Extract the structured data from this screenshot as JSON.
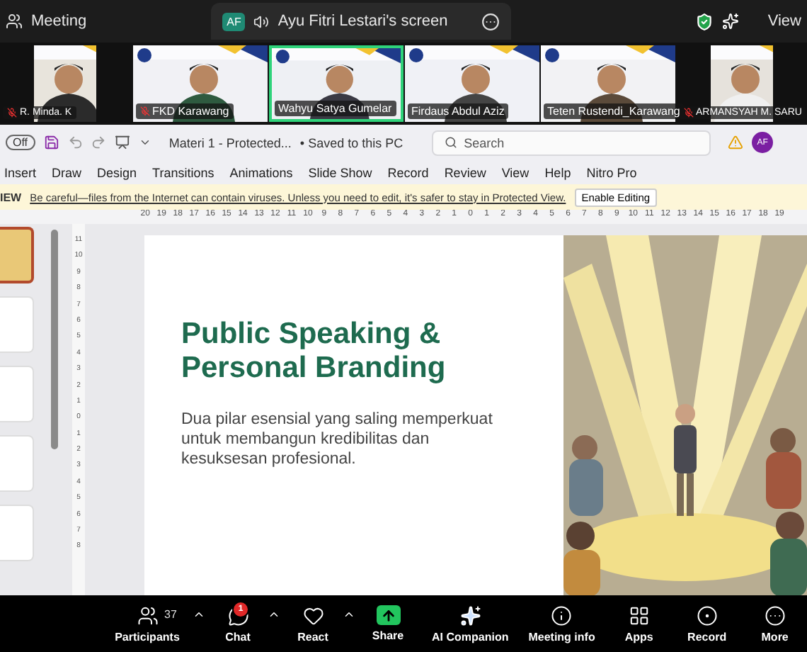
{
  "top_bar": {
    "title": "Meeting",
    "share_badge": "AF",
    "share_label": "Ayu Fitri Lestari's screen",
    "view_label": "View"
  },
  "videos": [
    {
      "name": "R. Minda. K",
      "kind": "small",
      "muted": true,
      "active": false
    },
    {
      "name": "FKD Karawang",
      "kind": "tile",
      "muted": true,
      "active": false
    },
    {
      "name": "Wahyu Satya Gumelar",
      "kind": "tile",
      "muted": false,
      "active": true
    },
    {
      "name": "Firdaus Abdul Aziz",
      "kind": "tile",
      "muted": false,
      "active": false
    },
    {
      "name": "Teten Rustendi_Karawang",
      "kind": "tile",
      "muted": false,
      "active": false
    },
    {
      "name": "ARMANSYAH M. SARU",
      "kind": "small",
      "muted": true,
      "active": false
    }
  ],
  "ppt": {
    "toggle": "Off",
    "file_name": "Materi 1  -  Protected...",
    "save_status": "• Saved to this PC",
    "search": {
      "placeholder": "Search"
    },
    "avatar": "AF",
    "tabs": [
      "Insert",
      "Draw",
      "Design",
      "Transitions",
      "Animations",
      "Slide Show",
      "Record",
      "Review",
      "View",
      "Help",
      "Nitro Pro"
    ],
    "protected": {
      "label": "IEW",
      "message": "Be careful—files from the Internet can contain viruses. Unless you need to edit, it's safer to stay in Protected View.",
      "button": "Enable Editing"
    },
    "ruler": [
      "20",
      "19",
      "18",
      "17",
      "16",
      "15",
      "14",
      "13",
      "12",
      "11",
      "10",
      "9",
      "8",
      "7",
      "6",
      "5",
      "4",
      "3",
      "2",
      "1",
      "0",
      "1",
      "2",
      "3",
      "4",
      "5",
      "6",
      "7",
      "8",
      "9",
      "10",
      "11",
      "12",
      "13",
      "14",
      "15",
      "16",
      "17",
      "18",
      "19"
    ],
    "vruler": [
      "11",
      "10",
      "9",
      "8",
      "7",
      "6",
      "5",
      "4",
      "3",
      "2",
      "1",
      "0",
      "1",
      "2",
      "3",
      "4",
      "5",
      "6",
      "7",
      "8"
    ],
    "thumbnails": [
      {
        "selected": true
      },
      {
        "selected": false
      },
      {
        "selected": false
      },
      {
        "selected": false
      },
      {
        "selected": false
      }
    ],
    "slide": {
      "title": [
        "Public Speaking &",
        "Personal Branding"
      ],
      "subtitle": "Dua pilar esensial yang saling memperkuat untuk membangun kredibilitas dan kesuksesan profesional."
    }
  },
  "toolbar": [
    {
      "kind": "participants",
      "label": "Participants",
      "count": "37",
      "caret": true
    },
    {
      "kind": "chat",
      "label": "Chat",
      "badge": "1",
      "caret": true
    },
    {
      "kind": "react",
      "label": "React",
      "caret": true
    },
    {
      "kind": "share",
      "label": "Share",
      "caret": false
    },
    {
      "kind": "ai",
      "label": "AI Companion",
      "caret": false
    },
    {
      "kind": "info",
      "label": "Meeting info",
      "caret": false
    },
    {
      "kind": "apps",
      "label": "Apps",
      "caret": false
    },
    {
      "kind": "record",
      "label": "Record",
      "caret": false
    },
    {
      "kind": "more",
      "label": "More",
      "caret": false
    }
  ]
}
